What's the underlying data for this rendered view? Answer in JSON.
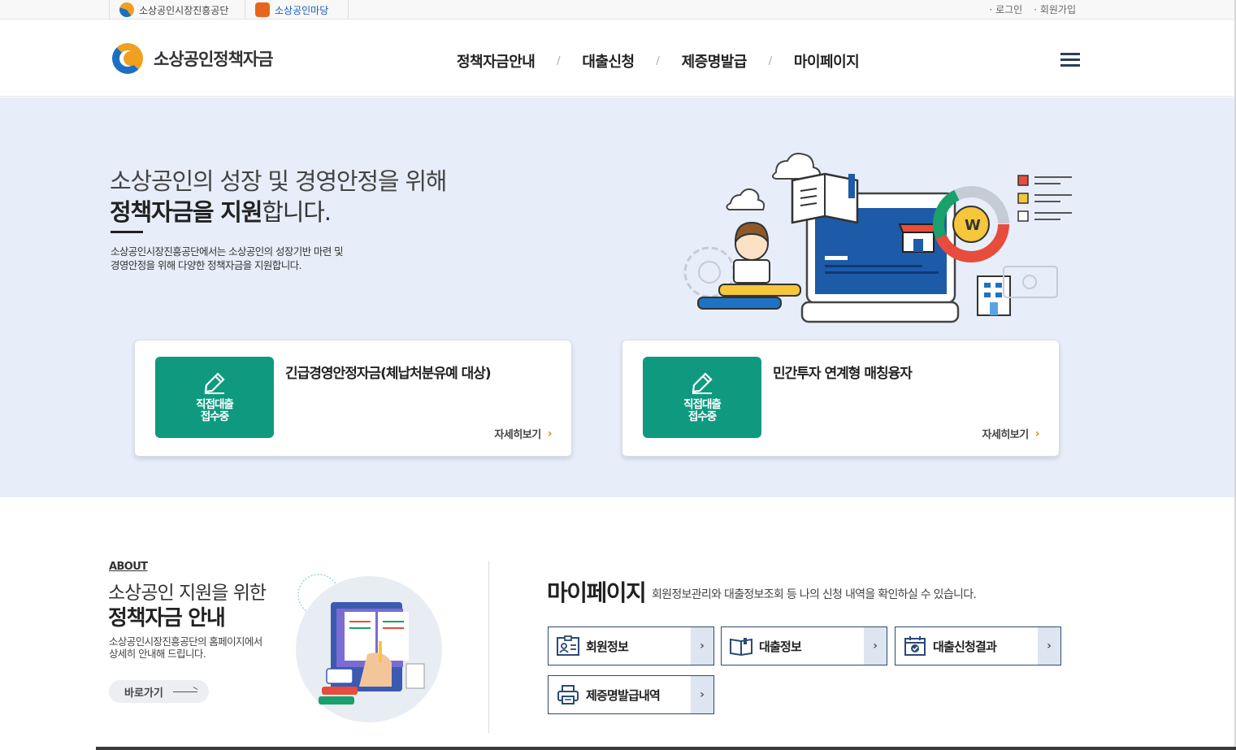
{
  "family_sites": [
    "소상공인시장진흥공단",
    "소상공인마당"
  ],
  "util_links": [
    "로그인",
    "회원가입"
  ],
  "header": {
    "logo_text": "소상공인정책자금",
    "nav": [
      "정책자금안내",
      "대출신청",
      "제증명발급",
      "마이페이지"
    ],
    "menu_icon": "hamburger-icon"
  },
  "hero": {
    "line1": "소상공인의 성장 및 경영안정을 위해",
    "line2_bold": "정책자금을 지원",
    "line2_rest": "합니다.",
    "desc_line1": "소상공인시장진흥공단에서는 소상공인의 성장기반 마련 및",
    "desc_line2": "경영안정을 위해 다양한 정책자금을 지원합니다."
  },
  "cards": [
    {
      "badge_line1": "직접대출",
      "badge_line2": "접수중",
      "title": "긴급경영안정자금(체납처분유예 대상)",
      "more": "자세히보기"
    },
    {
      "badge_line1": "직접대출",
      "badge_line2": "접수중",
      "title": "민간투자 연계형 매칭융자",
      "more": "자세히보기"
    }
  ],
  "about": {
    "eyebrow": "ABOUT",
    "line1": "소상공인 지원을 위한",
    "line2": "정책자금 안내",
    "desc_line1": "소상공인시장진흥공단의 홈페이지에서",
    "desc_line2": "상세히 안내해 드립니다.",
    "go_label": "바로가기"
  },
  "mypage": {
    "title": "마이페이지",
    "desc": "회원정보관리와 대출정보조회 등 나의 신청 내역을 확인하실 수 있습니다.",
    "buttons": [
      {
        "label": "회원정보",
        "icon": "member-card-icon"
      },
      {
        "label": "대출정보",
        "icon": "book-icon"
      },
      {
        "label": "대출신청결과",
        "icon": "calendar-check-icon"
      },
      {
        "label": "제증명발급내역",
        "icon": "printer-icon"
      }
    ]
  },
  "colors": {
    "badge_green": "#0f9a80",
    "hero_bg": "#e7eef9",
    "accent_orange": "#e08a17",
    "navy": "#2b4a73"
  }
}
